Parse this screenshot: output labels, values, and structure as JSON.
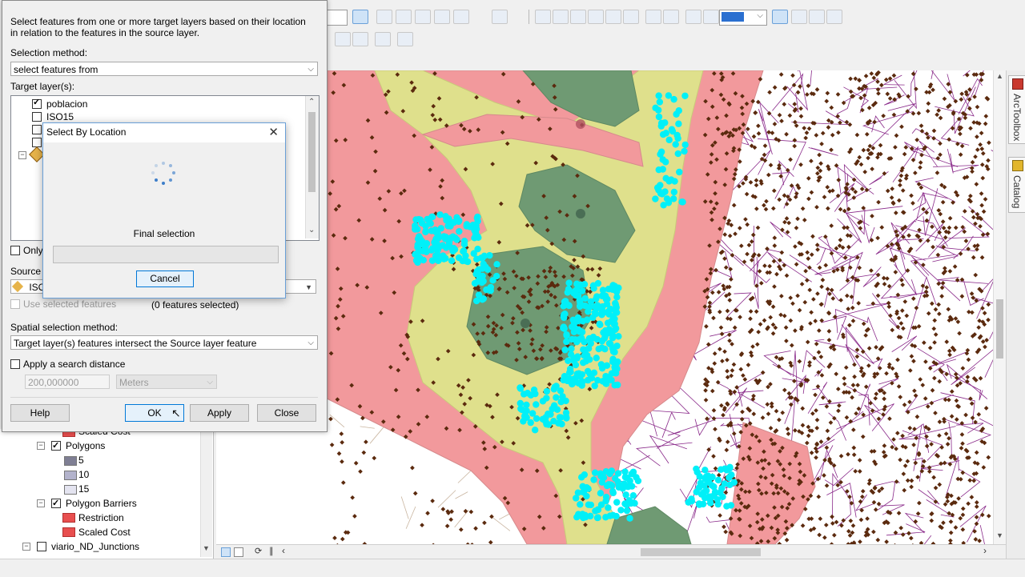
{
  "toolbar": {
    "zoom_value": ""
  },
  "dialog": {
    "description": "Select features from one or more target layers based on their location in relation to the features in the source layer.",
    "selection_method_label": "Selection method:",
    "selection_method_value": "select features from",
    "target_layers_label": "Target layer(s):",
    "target_layers": [
      {
        "name": "poblacion",
        "checked": true
      },
      {
        "name": "ISO15",
        "checked": false
      },
      {
        "name": "",
        "checked": false
      },
      {
        "name": "",
        "checked": false
      }
    ],
    "only_label": "Only",
    "source_layer_label": "Source la",
    "source_layer_value": "ISO",
    "use_selected_label": "Use selected features",
    "features_selected": "(0 features selected)",
    "spatial_method_label": "Spatial selection method:",
    "spatial_method_value": "Target layer(s) features intersect the Source layer feature",
    "search_distance_label": "Apply a search distance",
    "search_distance_value": "200,000000",
    "search_distance_unit": "Meters",
    "buttons": {
      "help": "Help",
      "ok": "OK",
      "apply": "Apply",
      "close": "Close"
    }
  },
  "progress": {
    "title": "Select By Location",
    "status": "Final selection",
    "cancel": "Cancel"
  },
  "toc": {
    "items": [
      {
        "label": "Scaled Cost",
        "type": "symbol"
      },
      {
        "label": "Polygons",
        "type": "layer",
        "checked": true
      },
      {
        "label": "5",
        "type": "class",
        "color": "#7f7f94"
      },
      {
        "label": "10",
        "type": "class",
        "color": "#b3b3cc"
      },
      {
        "label": "15",
        "type": "class",
        "color": "#e4e4f0"
      },
      {
        "label": "Polygon Barriers",
        "type": "layer",
        "checked": true
      },
      {
        "label": "Restriction",
        "type": "symbol"
      },
      {
        "label": "Scaled Cost",
        "type": "symbol"
      },
      {
        "label": "viario_ND_Junctions",
        "type": "layer",
        "checked": false
      }
    ]
  },
  "right_tabs": [
    "ArcToolbox",
    "Catalog"
  ],
  "colors": {
    "zone_red": "#f2999c",
    "zone_yellow": "#dfe08c",
    "zone_green": "#6f9a73",
    "points_cyan": "#00f0f8",
    "points_brown": "#5b2a0e",
    "roads": "#8a2a8a",
    "accent": "#0078d7"
  }
}
